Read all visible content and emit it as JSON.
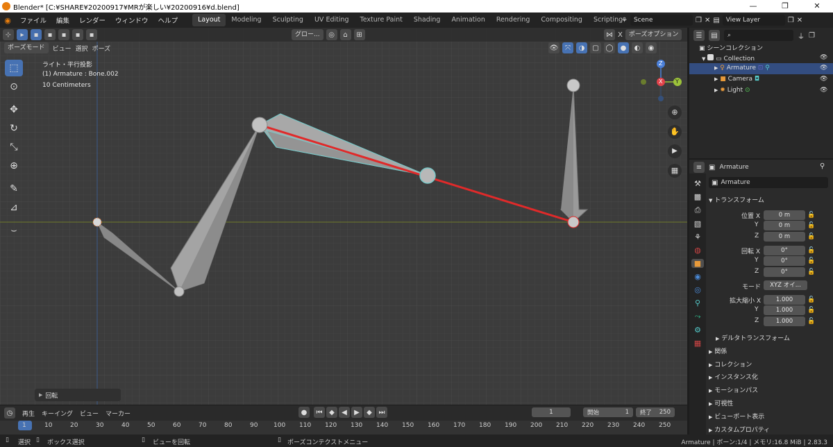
{
  "titlebar": {
    "title": "Blender* [C:¥SHARE¥20200917¥MRが楽しい¥20200916¥d.blend]",
    "minimize": "—",
    "maximize": "❐",
    "close": "✕"
  },
  "menu": {
    "items": [
      "ファイル",
      "編集",
      "レンダー",
      "ウィンドウ",
      "ヘルプ"
    ]
  },
  "workspaces": [
    "Layout",
    "Modeling",
    "Sculpting",
    "UV Editing",
    "Texture Paint",
    "Shading",
    "Animation",
    "Rendering",
    "Compositing",
    "Scripting",
    "+"
  ],
  "scene": {
    "scene_name": "Scene",
    "view_layer": "View Layer"
  },
  "viewport": {
    "header": {
      "transform_orientation": "グロー...",
      "x_axis": "X",
      "pose_options": "ポーズオプション"
    },
    "header2": {
      "mode": "ポーズモード",
      "view": "ビュー",
      "select": "選択",
      "pose": "ポーズ"
    },
    "overlay_info": {
      "line1": "ライト・平行投影",
      "line2": "(1) Armature : Bone.002",
      "line3": "10 Centimeters"
    },
    "gizmo": {
      "z": "Z",
      "x": "X",
      "y": "Y"
    },
    "last_op": "回転"
  },
  "outliner": {
    "root": "シーンコレクション",
    "items": [
      {
        "label": "Collection"
      },
      {
        "label": "Armature"
      },
      {
        "label": "Camera"
      },
      {
        "label": "Light"
      }
    ]
  },
  "properties": {
    "object_name": "Armature",
    "data_name": "Armature",
    "transform_header": "トランスフォーム",
    "location": {
      "label": "位置 X",
      "x": "0 m",
      "y": "0 m",
      "z": "0 m"
    },
    "rotation": {
      "label": "回転 X",
      "x": "0°",
      "y": "0°",
      "z": "0°"
    },
    "mode": {
      "label": "モード",
      "value": "XYZ オイ..."
    },
    "scale": {
      "label": "拡大縮小 X",
      "x": "1.000",
      "y": "1.000",
      "z": "1.000"
    },
    "axis_y": "Y",
    "axis_z": "Z",
    "sections": [
      "デルタトランスフォーム",
      "関係",
      "コレクション",
      "インスタンス化",
      "モーションパス",
      "可視性",
      "ビューポート表示",
      "カスタムプロパティ"
    ]
  },
  "timeline": {
    "playback": "再生",
    "keying": "キーイング",
    "view": "ビュー",
    "marker": "マーカー",
    "current_frame": "1",
    "start_label": "開始",
    "start": "1",
    "end_label": "終了",
    "end": "250",
    "ticks": [
      "1",
      "10",
      "20",
      "30",
      "40",
      "50",
      "60",
      "70",
      "80",
      "90",
      "100",
      "110",
      "120",
      "130",
      "140",
      "150",
      "160",
      "170",
      "180",
      "190",
      "200",
      "210",
      "220",
      "230",
      "240",
      "250"
    ]
  },
  "statusbar": {
    "select": "選択",
    "box_select": "ボックス選択",
    "rotate_view": "ビューを回転",
    "context_menu": "ポーズコンテクストメニュー",
    "info": "Armature | ボーン:1/4 | メモリ:16.8 MiB | 2.83.3"
  },
  "colors": {
    "accent": "#4772b3",
    "selected_bone": "#78c8c8",
    "active_line": "#e02a2a"
  }
}
